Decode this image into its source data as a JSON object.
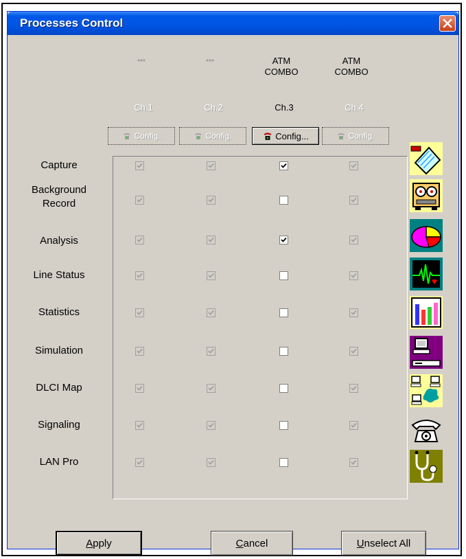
{
  "window": {
    "title": "Processes Control"
  },
  "channels": [
    {
      "top": "***",
      "name": "Ch.1",
      "config": "Config.",
      "enabled": false
    },
    {
      "top": "***",
      "name": "Ch.2",
      "config": "Config.",
      "enabled": false
    },
    {
      "top": "ATM COMBO",
      "top_line1": "ATM",
      "top_line2": "COMBO",
      "name": "Ch.3",
      "config": "Config...",
      "enabled": true
    },
    {
      "top": "ATM COMBO",
      "top_line1": "ATM",
      "top_line2": "COMBO",
      "name": "Ch.4",
      "config": "Config.",
      "enabled": false
    }
  ],
  "processes": [
    {
      "label": "Capture",
      "icon": "clipboard-icon",
      "ch3_checked": true
    },
    {
      "label": "Background Record",
      "line1": "Background",
      "line2": "Record",
      "icon": "tape-recorder-icon",
      "ch3_checked": false
    },
    {
      "label": "Analysis",
      "icon": "pie-chart-icon",
      "ch3_checked": true
    },
    {
      "label": "Line Status",
      "icon": "heartbeat-monitor-icon",
      "ch3_checked": false
    },
    {
      "label": "Statistics",
      "icon": "bar-chart-icon",
      "ch3_checked": false
    },
    {
      "label": "Simulation",
      "icon": "computer-terminal-icon",
      "ch3_checked": false
    },
    {
      "label": "DLCI Map",
      "icon": "network-map-icon",
      "ch3_checked": false
    },
    {
      "label": "Signaling",
      "icon": "telephone-icon",
      "ch3_checked": false
    },
    {
      "label": "LAN Pro",
      "icon": "stethoscope-icon",
      "ch3_checked": false
    }
  ],
  "buttons": {
    "apply": {
      "label": "Apply",
      "mnemonic": "A",
      "rest": "pply"
    },
    "cancel": {
      "label": "Cancel",
      "mnemonic": "C",
      "rest": "ancel"
    },
    "unselect_all": {
      "label": "Unselect All",
      "mnemonic": "U",
      "rest": "nselect All"
    }
  },
  "colors": {
    "titlebar": "#0054e3",
    "dialog": "#d4d0c8",
    "close": "#c6401a"
  }
}
